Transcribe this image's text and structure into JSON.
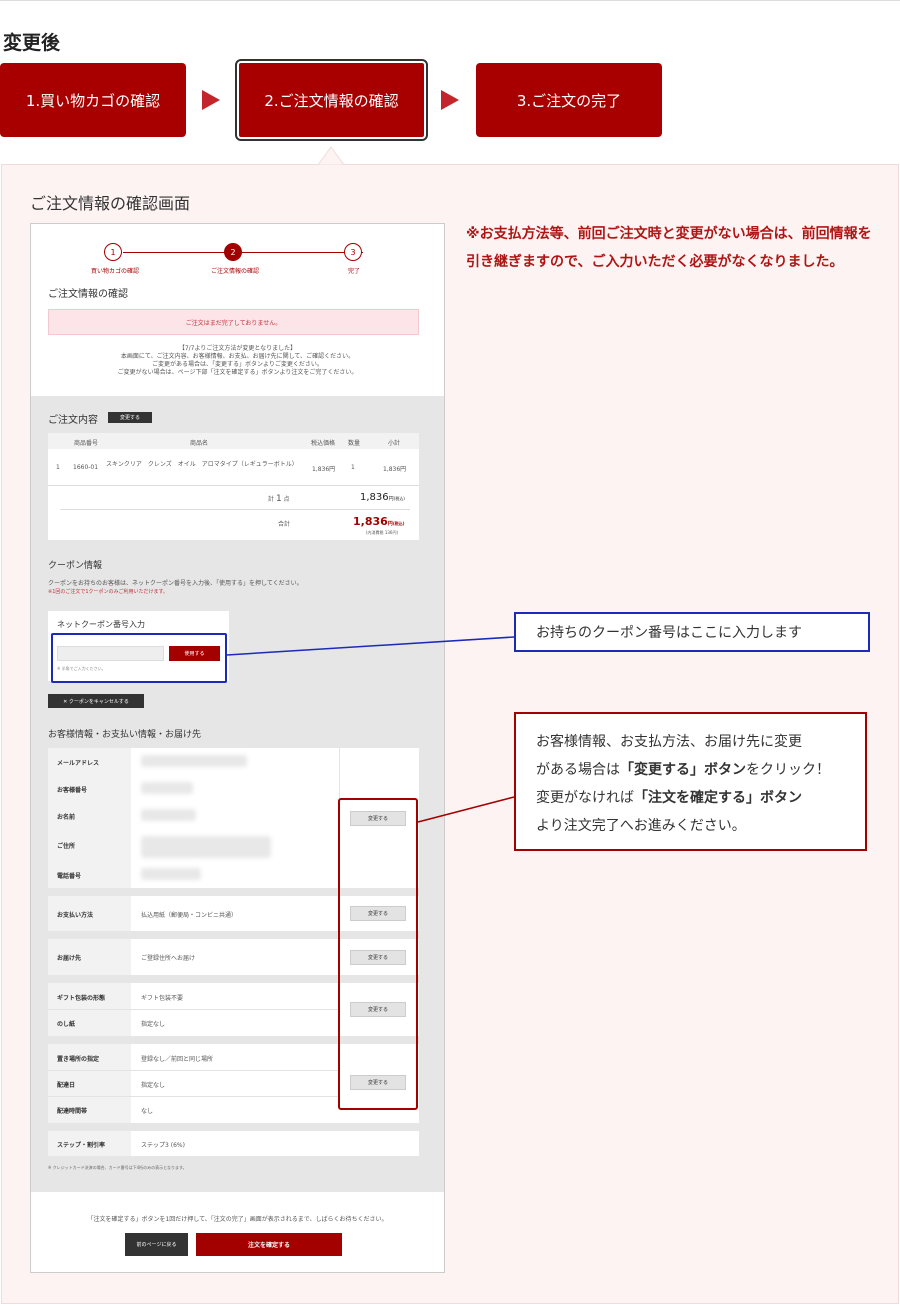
{
  "heading": "変更後",
  "steps": [
    {
      "label": "1.買い物カゴの確認"
    },
    {
      "label": "2.ご注文情報の確認"
    },
    {
      "label": "3.ご注文の完了"
    }
  ],
  "panel": {
    "title": "ご注文情報の確認画面",
    "note": "※お支払方法等、前回ご注文時と変更がない場合は、前回情報を引き継ぎますので、ご入力いただく必要がなくなりました。"
  },
  "shot": {
    "progress": [
      {
        "num": "1",
        "label": "買い物カゴの確認"
      },
      {
        "num": "2",
        "label": "ご注文情報の確認"
      },
      {
        "num": "3",
        "label": "完了"
      }
    ],
    "page_title": "ご注文情報の確認",
    "alert": "ご注文はまだ完了しておりません。",
    "notice1": "【7/7よりご注文方法が変更となりました】",
    "notice2": "本画面にて、ご注文内容、お客様情報、お支払、お届け先に関して、ご確認ください。",
    "notice3": "ご変更がある場合は、「変更する」ボタンよりご変更ください。",
    "notice4": "ご変更がない場合は、ページ下部「注文を確定する」ボタンより注文をご完了ください。",
    "order_title": "ご注文内容",
    "change_label": "変更する",
    "table_headers": [
      "商品番号",
      "商品名",
      "税込価格",
      "数量",
      "小計"
    ],
    "item": {
      "no": "1",
      "code": "1660-01",
      "name": "スキンクリア　クレンズ　オイル　アロマタイプ（レギュラーボトル）",
      "price": "1,836円",
      "qty": "1",
      "subtotal": "1,836円"
    },
    "total_count_label": "計",
    "total_count": "1",
    "total_count_unit": "点",
    "total_amount": "1,836",
    "yen_tax": "円",
    "tax_note": "(税込)",
    "grand_label": "合計",
    "grand_amount": "1,836",
    "grand_tax_note": "(内消費税 136円)",
    "coupon_title": "クーポン情報",
    "coupon_desc": "クーポンをお持ちのお客様は、ネットクーポン番号を入力後、「使用する」を押してください。",
    "coupon_warn": "※1回のご注文で1クーポンのみご利用いただけます。",
    "coupon_input_label": "ネットクーポン番号入力",
    "coupon_use": "使用する",
    "coupon_hint": "※ 半角でご入力ください。",
    "coupon_cancel": "✕ クーポンをキャンセルする",
    "info_title": "お客様情報・お支払い情報・お届け先",
    "info_rows": [
      "メールアドレス",
      "お客様番号",
      "お名前",
      "ご住所",
      "電話番号"
    ],
    "pay_label": "お支払い方法",
    "pay_value": "払込用紙（郵便局・コンビニ共通）",
    "ship_label": "お届け先",
    "ship_value": "ご登録住所へお届け",
    "gift_label": "ギフト包装の形態",
    "gift_value": "ギフト包装不要",
    "noshi_label": "のし紙",
    "noshi_value": "指定なし",
    "place_label": "置き場所の指定",
    "place_value": "登録なし／前回と同じ場所",
    "date_label": "配達日",
    "date_value": "指定なし",
    "time_label": "配達時間帯",
    "time_value": "なし",
    "stepdisc_label": "ステップ・割引率",
    "stepdisc_value": "ステップ3 (6%)",
    "card_note": "※ クレジットカード決済の場合、カード番号は下4桁のみの表示となります。",
    "confirm_note": "「注文を確定する」ボタンを1回だけ押して、「注文の完了」画面が表示されるまで、しばらくお待ちください。",
    "back_label": "前のページに戻る",
    "confirm_label": "注文を確定する"
  },
  "callouts": {
    "coupon": "お持ちのクーポン番号はここに入力します",
    "change_line1": "お客様情報、お支払方法、お届け先に変更",
    "change_line2a": "がある場合は",
    "change_line2b": "「変更する」ボタン",
    "change_line2c": "をクリック！",
    "change_line3a": "変更がなければ",
    "change_line3b": "「注文を確定する」ボタン",
    "change_line4": "より注文完了へお進みください。"
  },
  "colors": {
    "brand": "#a80000",
    "accent": "#c4252b",
    "callout_blue": "#1c2ab8"
  }
}
